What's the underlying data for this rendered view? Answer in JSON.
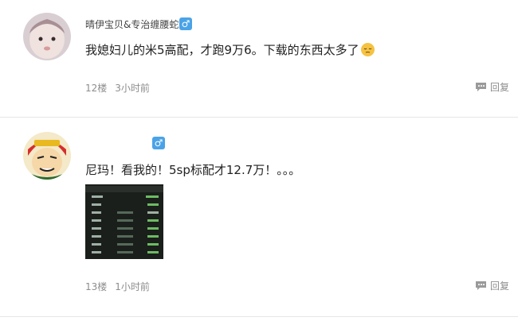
{
  "comments": [
    {
      "username": "晴伊宝贝&专治缠腰蛇",
      "gender_symbol": "♂",
      "text": "我媳妇儿的米5高配，才跑9万6。下载的东西太多了",
      "emoji": "pensive-face",
      "floor": "12楼",
      "time": "3小时前",
      "reply_label": "回复"
    },
    {
      "username": "",
      "gender_symbol": "♂",
      "text": "尼玛！看我的！5sp标配才12.7万！。。。",
      "floor": "13楼",
      "time": "1小时前",
      "reply_label": "回复"
    }
  ],
  "colors": {
    "badge": "#4aa3e8",
    "meta_text": "#8d8d8d",
    "divider": "#e6e6e6"
  }
}
